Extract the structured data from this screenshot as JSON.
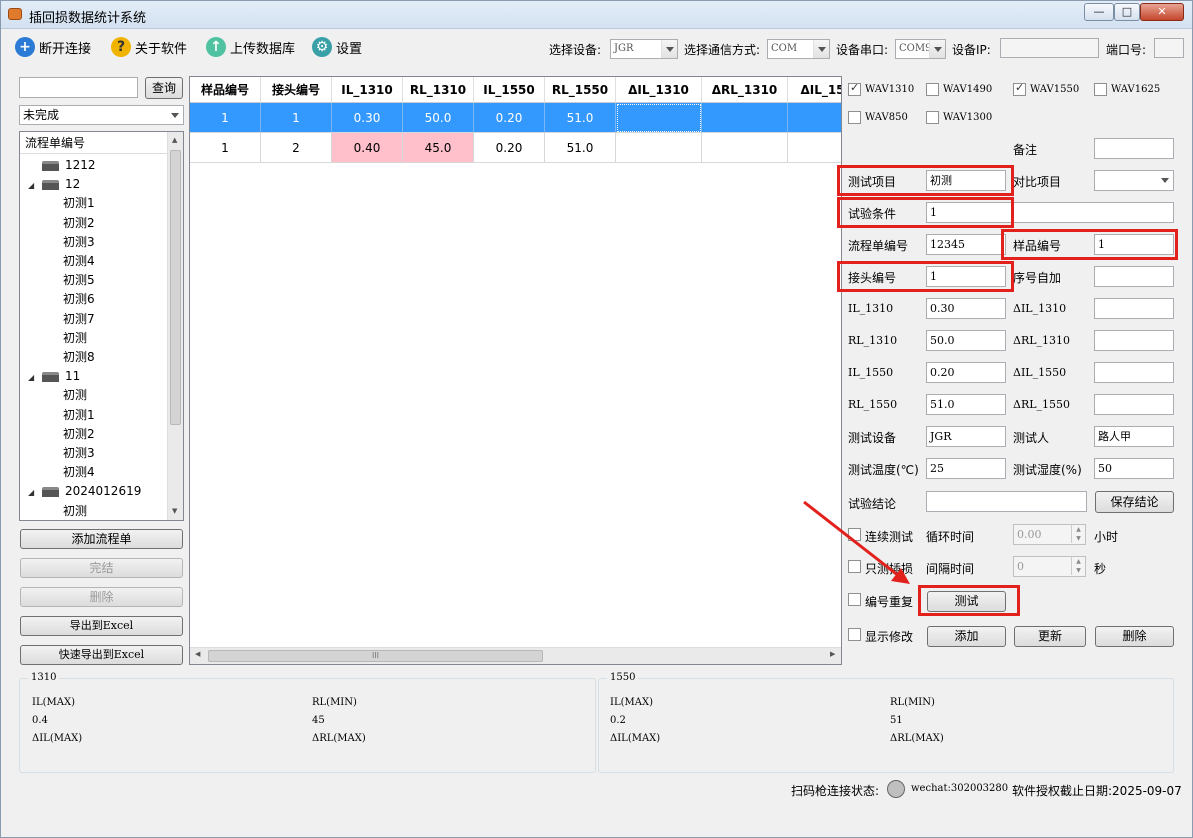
{
  "window": {
    "title": "插回损数据统计系统",
    "min": "—",
    "max": "□",
    "close": "✕"
  },
  "toolbar": {
    "disconnect": "断开连接",
    "about": "关于软件",
    "upload": "上传数据库",
    "settings": "设置",
    "device_label": "选择设备:",
    "device_value": "JGR",
    "comm_label": "选择通信方式:",
    "comm_value": "COM",
    "port_label": "设备串口:",
    "port_value": "COM9",
    "ip_label": "设备IP:",
    "ip_value": "",
    "portno_label": "端口号:",
    "portno_value": ""
  },
  "left": {
    "search_value": "",
    "query_btn": "查询",
    "status_value": "未完成",
    "tree_header": "流程单编号",
    "tree": [
      {
        "label": "1212",
        "type": "root",
        "expanded": false
      },
      {
        "label": "12",
        "type": "root",
        "expanded": true
      },
      {
        "label": "初测1",
        "type": "child"
      },
      {
        "label": "初测2",
        "type": "child"
      },
      {
        "label": "初测3",
        "type": "child"
      },
      {
        "label": "初测4",
        "type": "child"
      },
      {
        "label": "初测5",
        "type": "child"
      },
      {
        "label": "初测6",
        "type": "child"
      },
      {
        "label": "初测7",
        "type": "child"
      },
      {
        "label": "初测",
        "type": "child"
      },
      {
        "label": "初测8",
        "type": "child"
      },
      {
        "label": "11",
        "type": "root",
        "expanded": true
      },
      {
        "label": "初测",
        "type": "child"
      },
      {
        "label": "初测1",
        "type": "child"
      },
      {
        "label": "初测2",
        "type": "child"
      },
      {
        "label": "初测3",
        "type": "child"
      },
      {
        "label": "初测4",
        "type": "child"
      },
      {
        "label": "2024012619",
        "type": "root",
        "expanded": true
      },
      {
        "label": "初测",
        "type": "child"
      }
    ],
    "btn_add": "添加流程单",
    "btn_finish": "完结",
    "btn_delete": "删除",
    "btn_export": "导出到Excel",
    "btn_quick_export": "快速导出到Excel"
  },
  "grid": {
    "columns": [
      "样品编号",
      "接头编号",
      "IL_1310",
      "RL_1310",
      "IL_1550",
      "RL_1550",
      "ΔIL_1310",
      "ΔRL_1310",
      "ΔIL_15"
    ],
    "rows": [
      [
        "1",
        "1",
        "0.30",
        "50.0",
        "0.20",
        "51.0",
        "",
        "",
        ""
      ],
      [
        "1",
        "2",
        "0.40",
        "45.0",
        "0.20",
        "51.0",
        "",
        "",
        ""
      ]
    ],
    "scroll_grip": "III"
  },
  "right": {
    "checks": [
      {
        "label": "WAV1310",
        "checked": true
      },
      {
        "label": "WAV1490",
        "checked": false
      },
      {
        "label": "WAV1550",
        "checked": true
      },
      {
        "label": "WAV1625",
        "checked": false
      },
      {
        "label": "WAV850",
        "checked": false
      },
      {
        "label": "WAV1300",
        "checked": false
      }
    ],
    "remark_label": "备注",
    "remark_value": "",
    "test_item_label": "测试项目",
    "test_item_value": "初测",
    "compare_label": "对比项目",
    "compare_value": "",
    "condition_label": "试验条件",
    "condition_value": "1",
    "condition_extra": "",
    "flow_label": "流程单编号",
    "flow_value": "12345",
    "sample_label": "样品编号",
    "sample_value": "1",
    "joint_label": "接头编号",
    "joint_value": "1",
    "seq_label": "序号自加",
    "seq_value": "",
    "il1310_label": "IL_1310",
    "il1310_value": "0.30",
    "dil1310_label": "ΔIL_1310",
    "dil1310_value": "",
    "rl1310_label": "RL_1310",
    "rl1310_value": "50.0",
    "drl1310_label": "ΔRL_1310",
    "drl1310_value": "",
    "il1550_label": "IL_1550",
    "il1550_value": "0.20",
    "dil1550_label": "ΔIL_1550",
    "dil1550_value": "",
    "rl1550_label": "RL_1550",
    "rl1550_value": "51.0",
    "drl1550_label": "ΔRL_1550",
    "drl1550_value": "",
    "device_label": "测试设备",
    "device_value": "JGR",
    "tester_label": "测试人",
    "tester_value": "路人甲",
    "temp_label": "测试温度(℃)",
    "temp_value": "25",
    "humid_label": "测试湿度(%)",
    "humid_value": "50",
    "conclusion_label": "试验结论",
    "conclusion_value": "",
    "save_conclusion": "保存结论",
    "cont_test": "连续测试",
    "loop_label": "循环时间",
    "loop_value": "0.00",
    "hour": "小时",
    "only_loss": "只测插损",
    "interval_label": "间隔时间",
    "interval_value": "0",
    "sec": "秒",
    "dup": "编号重复",
    "test_btn": "测试",
    "show_edit": "显示修改",
    "add_btn": "添加",
    "update_btn": "更新",
    "delete_btn": "删除"
  },
  "summary": {
    "g1": {
      "title": "1310",
      "il_max_label": "IL(MAX)",
      "rl_min_label": "RL(MIN)",
      "il_val": "0.4",
      "rl_val": "45",
      "dil_label": "ΔIL(MAX)",
      "drl_label": "ΔRL(MAX)"
    },
    "g2": {
      "title": "1550",
      "il_max_label": "IL(MAX)",
      "rl_min_label": "RL(MIN)",
      "il_val": "0.2",
      "rl_val": "51",
      "dil_label": "ΔIL(MAX)",
      "drl_label": "ΔRL(MAX)"
    }
  },
  "status": {
    "scan_label": "扫码枪连接状态:",
    "wechat": "wechat:302003280",
    "license": "软件授权截止日期:2025-09-07"
  },
  "colors": {
    "selected_row": "#3399ff",
    "highlight": "#ffc0cb",
    "annotation": "#e2201c"
  }
}
